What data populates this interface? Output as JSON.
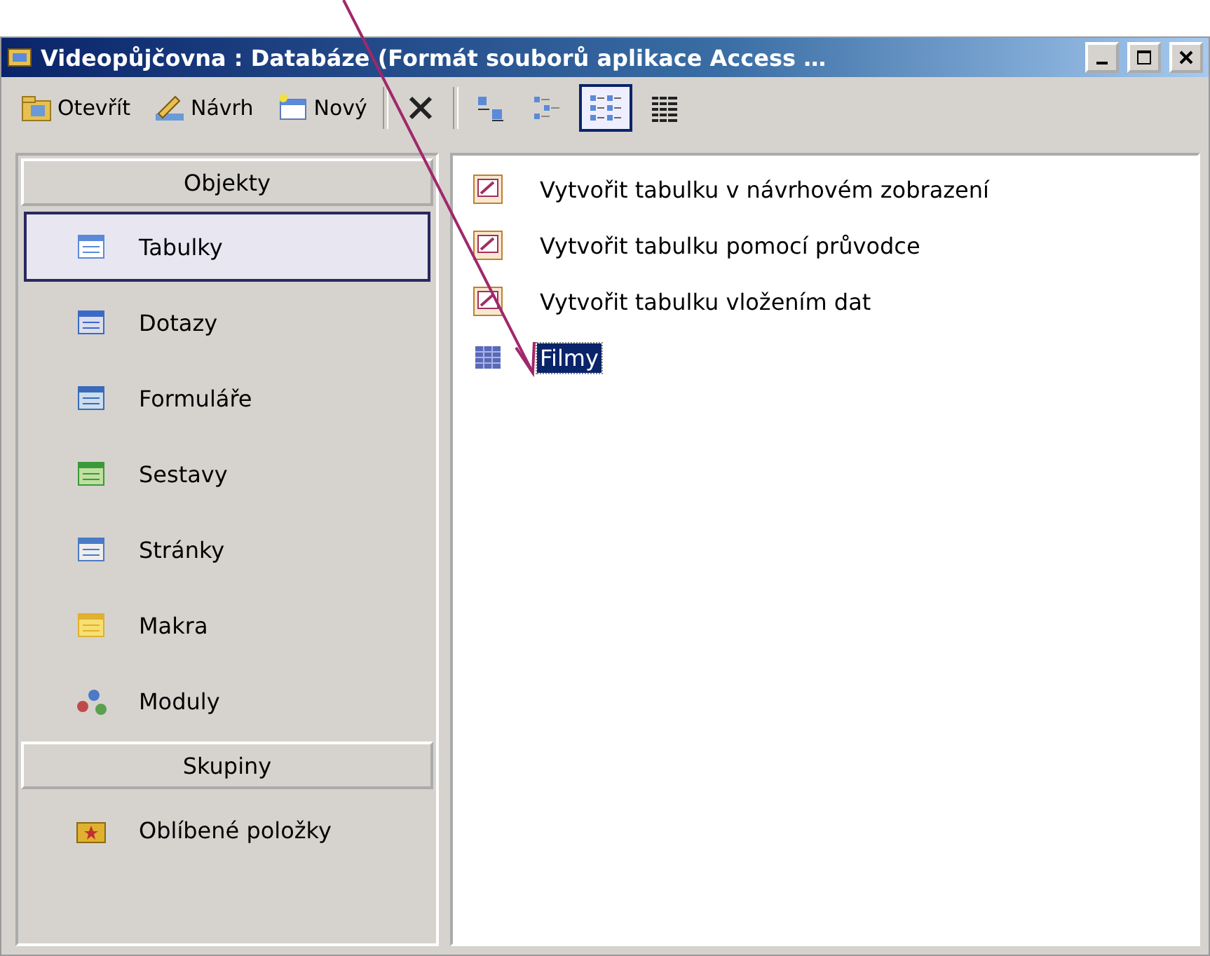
{
  "window": {
    "title": "Videopůjčovna : Databáze (Formát souborů aplikace Access …"
  },
  "toolbar": [
    {
      "kind": "open",
      "label": "Otevřít"
    },
    {
      "kind": "design",
      "label": "Návrh"
    },
    {
      "kind": "new",
      "label": "Nový"
    },
    {
      "kind": "separator"
    },
    {
      "kind": "delete",
      "selected": false
    },
    {
      "kind": "separator"
    },
    {
      "kind": "large",
      "selected": false
    },
    {
      "kind": "small",
      "selected": false
    },
    {
      "kind": "list",
      "selected": true
    },
    {
      "kind": "details",
      "selected": false
    }
  ],
  "sidebar": {
    "sections": [
      {
        "title": "Objekty",
        "items": [
          {
            "label": "Tabulky",
            "kind": "table",
            "selected": true
          },
          {
            "label": "Dotazy",
            "kind": "query",
            "selected": false
          },
          {
            "label": "Formuláře",
            "kind": "form",
            "selected": false
          },
          {
            "label": "Sestavy",
            "kind": "report",
            "selected": false
          },
          {
            "label": "Stránky",
            "kind": "page",
            "selected": false
          },
          {
            "label": "Makra",
            "kind": "macro",
            "selected": false
          },
          {
            "label": "Moduly",
            "kind": "module",
            "selected": false
          }
        ]
      },
      {
        "title": "Skupiny",
        "items": [
          {
            "label": "Oblíbené položky",
            "kind": "folder",
            "selected": false
          }
        ]
      }
    ]
  },
  "objects": [
    {
      "label": "Vytvořit tabulku v návrhovém zobrazení",
      "kind": "shortcut",
      "selected": false
    },
    {
      "label": "Vytvořit tabulku pomocí průvodce",
      "kind": "shortcut",
      "selected": false
    },
    {
      "label": "Vytvořit tabulku vložením dat",
      "kind": "shortcut",
      "selected": false
    },
    {
      "label": "Filmy",
      "kind": "table",
      "selected": true
    }
  ]
}
